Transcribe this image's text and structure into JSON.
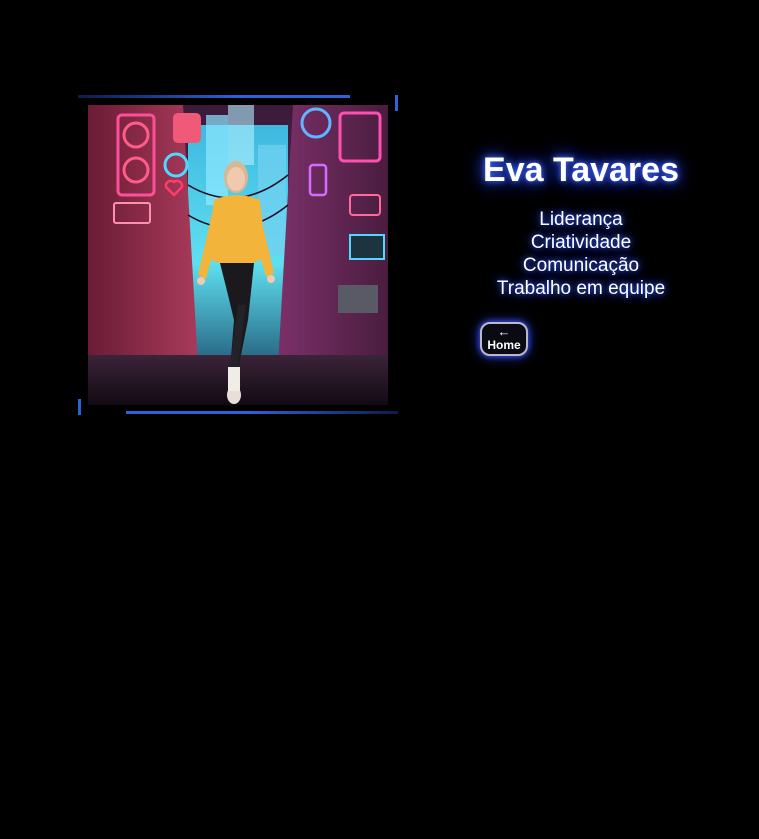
{
  "profile": {
    "name": "Eva Tavares",
    "skills": [
      "Liderança",
      "Criatividade",
      "Comunicação",
      "Trabalho em equipe"
    ]
  },
  "nav": {
    "home_arrow": "←",
    "home_label": "Home"
  },
  "colors": {
    "background": "#000000",
    "accent_blue": "#2b63d9",
    "glow": "#2b4cff"
  }
}
